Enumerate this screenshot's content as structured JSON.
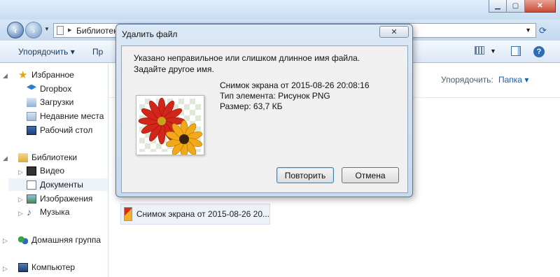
{
  "window": {
    "controls": {
      "minimize": "▁",
      "maximize": "▢",
      "close": "✕"
    }
  },
  "address": {
    "path": "Библиотеки"
  },
  "toolbar": {
    "organize": "Упорядочить ▾",
    "open": "Пр"
  },
  "sidebar": {
    "favorites": "Избранное",
    "dropbox": "Dropbox",
    "downloads": "Загрузки",
    "recent": "Недавние места",
    "desktop": "Рабочий стол",
    "libraries": "Библиотеки",
    "video": "Видео",
    "documents": "Документы",
    "images": "Изображения",
    "music": "Музыка",
    "homegroup": "Домашняя группа",
    "computer": "Компьютер"
  },
  "content": {
    "arrange_label": "Упорядочить:",
    "arrange_value": "Папка ▾",
    "file_name": "Снимок экрана от 2015-08-26 20..."
  },
  "dialog": {
    "title": "Удалить файл",
    "close_label": "✕",
    "message_line1": "Указано неправильное или слишком длинное имя файла.",
    "message_line2": "Задайте другое имя.",
    "file_title": "Снимок экрана от 2015-08-26 20:08:16",
    "file_type": "Тип элемента: Рисунок PNG",
    "file_size": "Размер: 63,7 КБ",
    "retry_label": "Повторить",
    "cancel_label": "Отмена"
  },
  "icons": {
    "favorites": "star-icon",
    "dropbox": "dropbox-icon",
    "downloads": "downloads-folder-icon",
    "recent": "recent-places-icon",
    "desktop": "desktop-icon",
    "libraries": "libraries-icon",
    "video": "video-library-icon",
    "documents": "documents-library-icon",
    "images": "images-library-icon",
    "music": "music-library-icon",
    "homegroup": "homegroup-icon",
    "computer": "computer-icon"
  }
}
